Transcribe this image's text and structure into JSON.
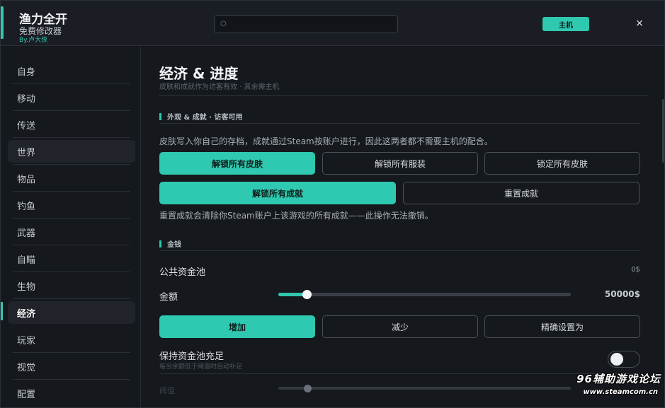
{
  "header": {
    "app_title": "渔力全开",
    "app_subtitle": "免费修改器",
    "author": "By.卢大侠",
    "search_icon_glyph": "○",
    "search_placeholder": "",
    "host_label": "主机",
    "close_glyph": "×",
    "accent_color": "#2fc8b0"
  },
  "sidebar": {
    "items": [
      {
        "label": "自身"
      },
      {
        "label": "移动"
      },
      {
        "label": "传送"
      },
      {
        "label": "世界"
      },
      {
        "label": "物品"
      },
      {
        "label": "钓鱼"
      },
      {
        "label": "武器"
      },
      {
        "label": "自瞄"
      },
      {
        "label": "生物"
      },
      {
        "label": "经济"
      },
      {
        "label": "玩家"
      },
      {
        "label": "视觉"
      },
      {
        "label": "配置"
      }
    ],
    "active_item": "经济"
  },
  "main": {
    "title": "经济 & 进度",
    "subtitle": "皮肤和成就作为访客有效 · 其余需主机",
    "sections": {
      "appearance": {
        "heading": "外观 & 成就 · 访客可用",
        "description": "皮肤写入你自己的存档，成就通过Steam按账户进行，因此这两者都不需要主机的配合。",
        "buttons": {
          "unlock_skins": "解锁所有皮肤",
          "unlock_outfits": "解锁所有服装",
          "lock_skins": "锁定所有皮肤",
          "unlock_achievements": "解锁所有成就",
          "reset_achievements": "重置成就"
        },
        "warning": "重置成就会清除你Steam账户上该游戏的所有成就——此操作无法撤销。"
      },
      "money": {
        "heading": "金钱",
        "pool_label": "公共资金池",
        "pool_value": "0$",
        "amount_label": "金额",
        "amount_value": "50000$",
        "amount_slider_level": 0.1,
        "buttons": {
          "increase": "增加",
          "decrease": "减少",
          "set_exact": "精确设置为"
        },
        "keep_full_label": "保持资金池充足",
        "keep_full_hint": "每当余额低于阈值时自动补足",
        "keep_full_enabled": false,
        "threshold_label": "阈值",
        "threshold_slider_level": 0.1
      }
    }
  },
  "watermark": {
    "line1": "96辅助游戏论坛",
    "line2": "www.steamcom.cn"
  }
}
